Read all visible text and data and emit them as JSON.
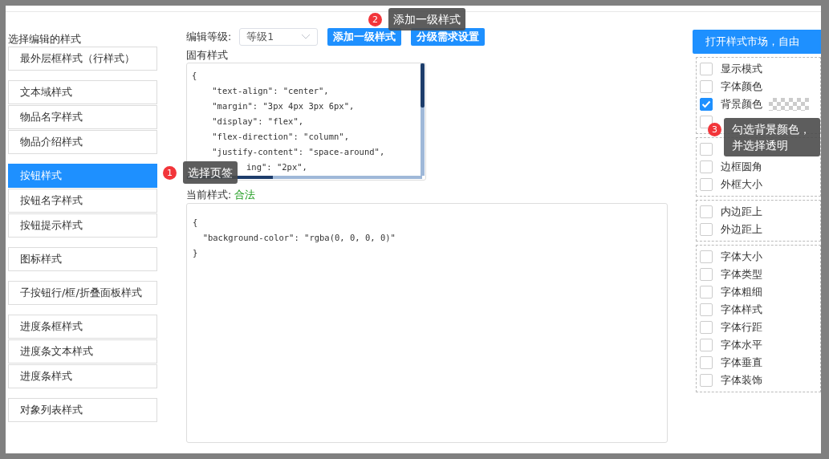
{
  "left_panel": {
    "title": "选择编辑的样式",
    "groups": [
      [
        {
          "label": "最外层框样式（行样式）",
          "selected": false
        }
      ],
      [
        {
          "label": "文本域样式",
          "selected": false
        },
        {
          "label": "物品名字样式",
          "selected": false
        },
        {
          "label": "物品介绍样式",
          "selected": false
        }
      ],
      [
        {
          "label": "按钮样式",
          "selected": true
        },
        {
          "label": "按钮名字样式",
          "selected": false
        },
        {
          "label": "按钮提示样式",
          "selected": false
        }
      ],
      [
        {
          "label": "图标样式",
          "selected": false
        }
      ],
      [
        {
          "label": "子按钮行/框/折叠面板样式",
          "selected": false
        }
      ],
      [
        {
          "label": "进度条框样式",
          "selected": false
        },
        {
          "label": "进度条文本样式",
          "selected": false
        },
        {
          "label": "进度条样式",
          "selected": false
        }
      ],
      [
        {
          "label": "对象列表样式",
          "selected": false
        }
      ]
    ]
  },
  "editor": {
    "level_label": "编辑等级:",
    "level_select": "等级1",
    "buttons": [
      "添加一级样式",
      "分级需求设置"
    ],
    "inherent_title": "固有样式",
    "inherent_code": [
      "{",
      "    \"text-align\": \"center\",",
      "    \"margin\": \"3px 4px 3px 6px\",",
      "    \"display\": \"flex\",",
      "    \"flex-direction\": \"column\",",
      "    \"justify-content\": \"space-around\",",
      {
        "text": "ing\": \"2px\",",
        "kind": "partial"
      }
    ],
    "current_label": "当前样式:",
    "current_status": "合法",
    "current_code": [
      "{",
      "  \"background-color\": \"rgba(0, 0, 0, 0)\"",
      "}"
    ]
  },
  "right_panel": {
    "market_button": "打开样式市场，自由",
    "groups": [
      [
        {
          "label": "显示模式",
          "checked": false
        },
        {
          "label": "字体颜色",
          "checked": false
        },
        {
          "label": "背景颜色",
          "checked": true,
          "kind": "color"
        },
        {
          "checked": false
        }
      ],
      [
        {
          "checked": false
        },
        {
          "label": "边框圆角",
          "checked": false
        },
        {
          "label": "外框大小",
          "checked": false
        }
      ],
      [
        {
          "label": "内边距上",
          "checked": false
        },
        {
          "label": "外边距上",
          "checked": false
        }
      ],
      [
        {
          "label": "字体大小",
          "checked": false
        },
        {
          "label": "字体类型",
          "checked": false
        },
        {
          "label": "字体粗细",
          "checked": false
        },
        {
          "label": "字体样式",
          "checked": false
        },
        {
          "label": "字体行距",
          "checked": false
        },
        {
          "label": "字体水平",
          "checked": false
        },
        {
          "label": "字体垂直",
          "checked": false
        },
        {
          "label": "字体装饰",
          "checked": false
        }
      ]
    ]
  },
  "callouts": [
    {
      "number": "1",
      "text": "选择页签"
    },
    {
      "number": "2",
      "text": "添加一级样式"
    },
    {
      "number": "3",
      "text": "勾选背景颜色，并选择透明"
    }
  ]
}
